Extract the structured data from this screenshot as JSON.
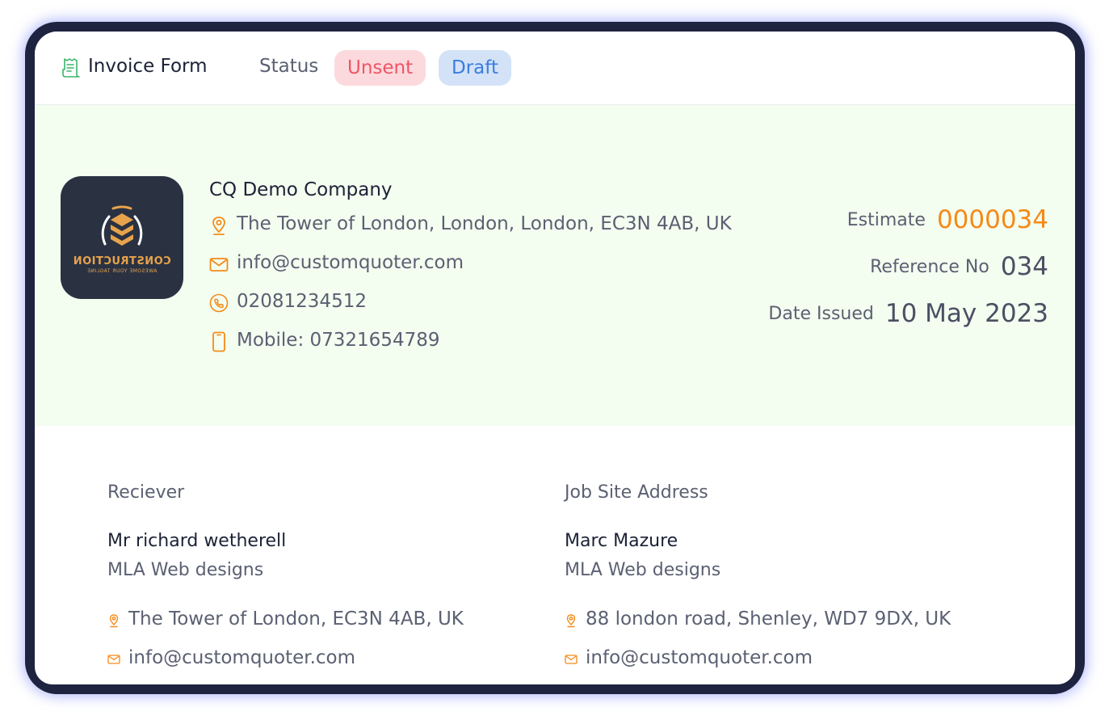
{
  "header": {
    "title": "Invoice Form",
    "title_icon": "receipt-icon",
    "status_label": "Status",
    "badges": [
      {
        "label": "Unsent",
        "bg": "#fcd9dd",
        "color": "#ee5565"
      },
      {
        "label": "Draft",
        "bg": "#d3e2f7",
        "color": "#3a7dde"
      }
    ]
  },
  "company": {
    "logo": {
      "text": "CONSTRUCTION",
      "tagline": "AWESOME YOUR TAGLINE"
    },
    "name": "CQ Demo Company",
    "address": "The Tower of London, London, London, EC3N 4AB, UK",
    "email": "info@customquoter.com",
    "phone": "02081234512",
    "mobile": "Mobile: 07321654789",
    "icons": [
      "location-pin-icon",
      "mail-icon",
      "phone-icon",
      "mobile-icon"
    ]
  },
  "meta": {
    "estimate_label": "Estimate",
    "estimate_value": "0000034",
    "reference_label": "Reference No",
    "reference_value": "034",
    "date_label": "Date Issued",
    "date_value": "10 May 2023"
  },
  "receiver": {
    "heading": "Reciever",
    "name": "Mr richard wetherell",
    "company": "MLA Web designs",
    "address": "The Tower of London, EC3N 4AB, UK",
    "email": "info@customquoter.com"
  },
  "job_site": {
    "heading": "Job Site Address",
    "name": "Marc Mazure",
    "company": "MLA Web designs",
    "address": "88 london road, Shenley, WD7 9DX, UK",
    "email": "info@customquoter.com"
  },
  "colors": {
    "accent_orange": "#f58a17",
    "accent_green": "#3bb56a",
    "panel_bg": "#f3fdf0",
    "frame": "#1e2340"
  }
}
